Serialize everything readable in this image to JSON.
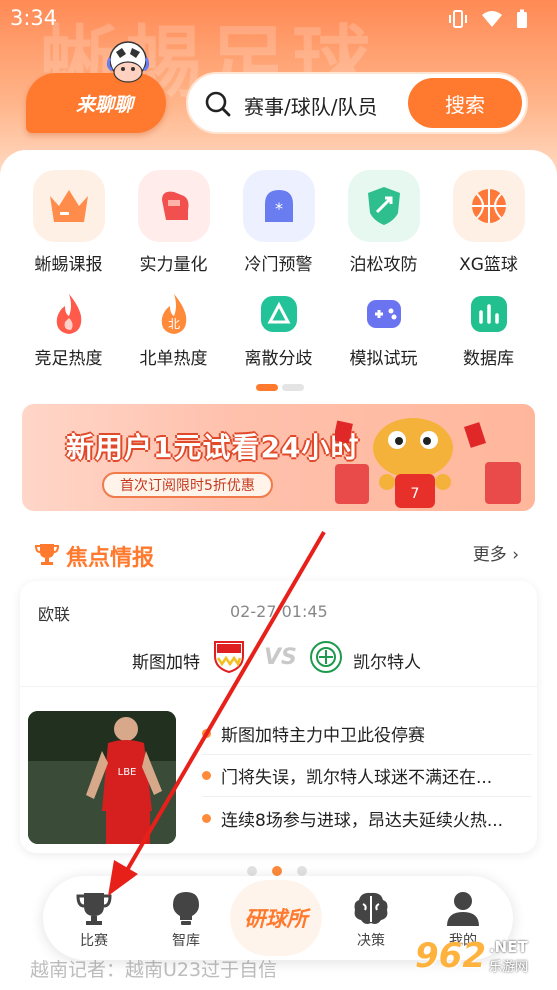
{
  "status_bar": {
    "time": "3:34"
  },
  "header": {
    "watermark": "蜥蜴足球",
    "chat_label": "来聊聊",
    "search": {
      "placeholder": "赛事/球队/队员",
      "button": "搜索"
    }
  },
  "grid": {
    "row1": [
      {
        "label": "蜥蜴课报",
        "icon": "crown-icon",
        "color": "#ff8c4a"
      },
      {
        "label": "实力量化",
        "icon": "boxing-glove-icon",
        "color": "#f24f4f"
      },
      {
        "label": "冷门预警",
        "icon": "alert-icon",
        "color": "#6a7df0"
      },
      {
        "label": "泊松攻防",
        "icon": "shield-icon",
        "color": "#2fbf8f"
      },
      {
        "label": "XG篮球",
        "icon": "basketball-icon",
        "color": "#ff7a3a"
      }
    ],
    "row2": [
      {
        "label": "竞足热度",
        "icon": "flame-icon",
        "color": "#ff5a4a"
      },
      {
        "label": "北单热度",
        "icon": "flame-bei-icon",
        "color": "#ff8a3a"
      },
      {
        "label": "离散分歧",
        "icon": "triangle-icon",
        "color": "#23c39a"
      },
      {
        "label": "模拟试玩",
        "icon": "gamepad-icon",
        "color": "#6b74f0"
      },
      {
        "label": "数据库",
        "icon": "chart-icon",
        "color": "#22c08f"
      }
    ]
  },
  "banner": {
    "title": "新用户1元试看24小时",
    "subtitle": "首次订阅限时5折优惠"
  },
  "focus": {
    "title": "焦点情报",
    "more": "更多 ›",
    "match": {
      "league": "欧联",
      "time": "02-27 01:45",
      "home": "斯图加特",
      "away": "凯尔特人",
      "vs": "VS"
    },
    "news": [
      "斯图加特主力中卫此役停赛",
      "门将失误，凯尔特人球迷不满还在...",
      "连续8场参与进球，昂达夫延续火热..."
    ]
  },
  "under_content": "越南记者：越南U23过于自信",
  "bottom_nav": {
    "items": [
      {
        "label": "比赛",
        "icon": "trophy-icon"
      },
      {
        "label": "智库",
        "icon": "bulb-icon"
      },
      {
        "label": "研球所",
        "icon": "lab-icon"
      },
      {
        "label": "决策",
        "icon": "brain-icon"
      },
      {
        "label": "我的",
        "icon": "user-icon"
      }
    ]
  },
  "site_watermark": {
    "num": "962",
    "net": ".NET",
    "cn": "乐游网"
  },
  "colors": {
    "accent": "#ff7a2e",
    "arrow": "#e8201a"
  }
}
